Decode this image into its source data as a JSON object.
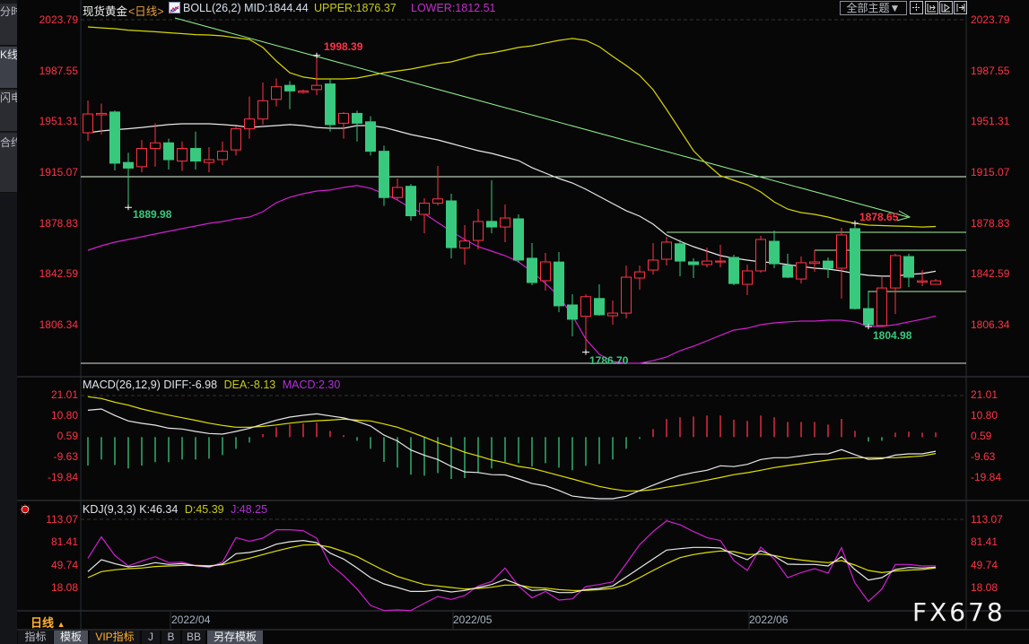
{
  "sidebar": {
    "tabs": [
      {
        "label": "分时图",
        "active": false
      },
      {
        "label": "K线图",
        "active": true
      },
      {
        "label": "闪电图",
        "active": false
      },
      {
        "label": "合约资料",
        "active": false
      }
    ]
  },
  "header": {
    "symbol": "现货黄金",
    "period": "<日线>",
    "indicator_icon": "chart-icon",
    "boll_mid": "BOLL(26,2) MID:1844.44",
    "boll_upper": "UPPER:1876.37",
    "boll_lower": "LOWER:1812.51",
    "theme_button": "全部主题▼",
    "tool_icons": [
      "crosshair-icon",
      "zoom-left-icon",
      "play-forward-icon",
      "jump-end-icon"
    ]
  },
  "macd_header": {
    "name": "MACD(26,12,9)",
    "diff": "DIFF:-6.98",
    "dea": "DEA:-8.13",
    "macd": "MACD:2.30"
  },
  "kdj_header": {
    "name": "KDJ(9,3,3)",
    "k": "K:46.34",
    "d": "D:45.39",
    "j": "J:48.25"
  },
  "footer": {
    "period_label": "日线",
    "period_arrow": "▲",
    "dates": [
      "2022/04",
      "2022/05",
      "2022/06"
    ],
    "tabs": [
      {
        "label": "指标",
        "highlight": false
      },
      {
        "label": "模板",
        "highlight": true
      },
      {
        "label": "VIP指标",
        "highlight": false
      },
      {
        "label": "J",
        "highlight": false
      },
      {
        "label": "B",
        "highlight": false
      },
      {
        "label": "BB",
        "highlight": false
      },
      {
        "label": "另存模板",
        "highlight": true
      }
    ],
    "watermark": "FX678"
  },
  "colors": {
    "up": "#ff3346",
    "down": "#38c97e",
    "boll_upper": "#d6d600",
    "boll_mid": "#e8e8e8",
    "boll_lower": "#d020d0",
    "diff": "#e8e8e8",
    "dea": "#e0e000",
    "k": "#e8e8e8",
    "d": "#e0e000",
    "j": "#d020d0",
    "axis_text": "#ff3346"
  },
  "chart_data": [
    {
      "type": "candlestick",
      "title": "现货黄金",
      "y_ticks": [
        "2023.79",
        "1987.55",
        "1951.31",
        "1915.07",
        "1878.83",
        "1842.59",
        "1806.34"
      ],
      "ylim": [
        1778.8,
        2023.79
      ],
      "x_ticks": [
        "2022/04",
        "2022/05",
        "2022/06"
      ],
      "ohlc": [
        [
          1943.2,
          1966.2,
          1937.4,
          1956.6
        ],
        [
          1956,
          1964,
          1942,
          1957
        ],
        [
          1958,
          1959,
          1916.3,
          1921.5
        ],
        [
          1922,
          1929,
          1889.98,
          1918
        ],
        [
          1919,
          1938,
          1915,
          1932
        ],
        [
          1932,
          1950,
          1919,
          1936
        ],
        [
          1936,
          1939,
          1917,
          1924
        ],
        [
          1923,
          1937,
          1916,
          1932
        ],
        [
          1932,
          1944,
          1917,
          1923
        ],
        [
          1922,
          1933,
          1915,
          1924
        ],
        [
          1924,
          1937,
          1920,
          1930
        ],
        [
          1931,
          1948,
          1927,
          1946
        ],
        [
          1946,
          1969,
          1939,
          1953
        ],
        [
          1953,
          1979,
          1949,
          1966
        ],
        [
          1967,
          1982,
          1962,
          1976
        ],
        [
          1977,
          1980,
          1960,
          1973
        ],
        [
          1972,
          1974,
          1971,
          1973
        ],
        [
          1974,
          1998.39,
          1970,
          1977
        ],
        [
          1978,
          1982,
          1944,
          1949
        ],
        [
          1950,
          1958,
          1939,
          1957
        ],
        [
          1957,
          1959,
          1937,
          1950
        ],
        [
          1951,
          1955,
          1927,
          1930
        ],
        [
          1930,
          1934,
          1891,
          1897
        ],
        [
          1897,
          1910.6,
          1895.2,
          1904.2
        ],
        [
          1905,
          1906.7,
          1880.5,
          1884
        ],
        [
          1885,
          1896.5,
          1871.6,
          1893
        ],
        [
          1893,
          1919.5,
          1891.4,
          1896
        ],
        [
          1894.6,
          1899.7,
          1853.6,
          1861.3
        ],
        [
          1861,
          1877.3,
          1849.2,
          1866
        ],
        [
          1866.4,
          1888.8,
          1860,
          1879.9
        ],
        [
          1880,
          1909.3,
          1871.6,
          1876
        ],
        [
          1876,
          1892,
          1865.2,
          1882.4
        ],
        [
          1881.8,
          1885,
          1850.5,
          1852.4
        ],
        [
          1853.7,
          1864.5,
          1834.5,
          1836.4
        ],
        [
          1837.7,
          1857.5,
          1830.6,
          1851.1
        ],
        [
          1851,
          1858.1,
          1815.3,
          1819.8
        ],
        [
          1820.4,
          1828.1,
          1798,
          1810.2
        ],
        [
          1812.3,
          1828,
          1786.7,
          1826.3
        ],
        [
          1825,
          1835.1,
          1812.7,
          1813.4
        ],
        [
          1812.7,
          1823.6,
          1806.3,
          1814.6
        ],
        [
          1814.6,
          1848.5,
          1810.8,
          1840.2
        ],
        [
          1839.6,
          1848.5,
          1831.3,
          1844.0
        ],
        [
          1845.3,
          1864.5,
          1842.1,
          1852.4
        ],
        [
          1853,
          1869,
          1848.5,
          1865.2
        ],
        [
          1864,
          1867,
          1840.9,
          1851.7
        ],
        [
          1851.1,
          1853.7,
          1839.6,
          1849.2
        ],
        [
          1849.2,
          1861.3,
          1847.2,
          1851.7
        ],
        [
          1851,
          1863.3,
          1847.2,
          1851.7
        ],
        [
          1854.3,
          1856.2,
          1834.5,
          1835.7
        ],
        [
          1835.1,
          1849.2,
          1827.4,
          1844.7
        ],
        [
          1844.7,
          1869.7,
          1843.4,
          1867.1
        ],
        [
          1865.8,
          1873.5,
          1846.6,
          1849.8
        ],
        [
          1848.5,
          1856.9,
          1839.6,
          1840.2
        ],
        [
          1838.9,
          1854.9,
          1835.7,
          1850.5
        ],
        [
          1850,
          1859.4,
          1844,
          1851.1
        ],
        [
          1851.7,
          1854.3,
          1839.6,
          1846.6
        ],
        [
          1846.6,
          1875.4,
          1824.9,
          1870.3
        ],
        [
          1874.8,
          1878.65,
          1817.2,
          1817.8
        ],
        [
          1817.8,
          1830.6,
          1804.98,
          1806.3
        ],
        [
          1805.7,
          1840.2,
          1805,
          1832.5
        ],
        [
          1832.5,
          1856.9,
          1814,
          1855.6
        ],
        [
          1854.9,
          1856.9,
          1833.2,
          1840.2
        ],
        [
          1836.7,
          1845.3,
          1833.8,
          1837.6
        ],
        [
          1835.1,
          1838.9,
          1835,
          1837.6
        ]
      ],
      "boll_upper": [
        2018.7,
        2018.0,
        2017.4,
        2016.4,
        2015.8,
        2015.2,
        2014.5,
        2013.9,
        2013.2,
        2012.9,
        2012.3,
        2011.0,
        2009.7,
        2004.0,
        1994.4,
        1986.0,
        1982.9,
        1981.6,
        1981.6,
        1981.6,
        1982.2,
        1984.1,
        1986.0,
        1987.3,
        1988.6,
        1990.5,
        1992.5,
        1993.7,
        1996.3,
        1998.9,
        2000.1,
        2002.0,
        2004.0,
        2005.2,
        2007.2,
        2009.1,
        2010.4,
        2009.1,
        2004.6,
        1997.6,
        1991.2,
        1984.1,
        1973.9,
        1959.8,
        1945.1,
        1930.4,
        1920.8,
        1912.5,
        1909.3,
        1906.1,
        1901.0,
        1893.9,
        1888.8,
        1886.3,
        1885.0,
        1883.1,
        1880.5,
        1878.6,
        1877.3,
        1877.0,
        1876.7,
        1876.4,
        1876.0,
        1876.37
      ],
      "boll_mid": [
        1943.2,
        1944.5,
        1945.4,
        1946.1,
        1947.0,
        1948.0,
        1949.0,
        1949.6,
        1949.6,
        1949.6,
        1949.0,
        1948.3,
        1947.0,
        1947.7,
        1948.3,
        1949.0,
        1948.3,
        1947.0,
        1946.4,
        1946.4,
        1948.3,
        1948.3,
        1947.0,
        1944.5,
        1941.9,
        1940.0,
        1938.1,
        1935.5,
        1932.9,
        1930.4,
        1928.5,
        1925.9,
        1923.4,
        1918.3,
        1914.4,
        1910.6,
        1907.4,
        1902.9,
        1897.8,
        1892.7,
        1887.6,
        1883.7,
        1878.0,
        1870.3,
        1865.8,
        1862.0,
        1858.8,
        1855.6,
        1853.7,
        1852.4,
        1851.1,
        1850.5,
        1849.2,
        1847.9,
        1846.6,
        1846.0,
        1844.7,
        1842.8,
        1841.5,
        1840.9,
        1840.9,
        1842.2,
        1842.8,
        1844.44
      ],
      "boll_lower": [
        1859.4,
        1862.6,
        1865.2,
        1867.1,
        1869.0,
        1871.0,
        1872.9,
        1874.8,
        1876.7,
        1878.6,
        1879.9,
        1881.8,
        1883.1,
        1886.9,
        1893.3,
        1897.2,
        1899.7,
        1901.6,
        1902.3,
        1904.2,
        1905.5,
        1903.6,
        1899.7,
        1895.2,
        1889.5,
        1885.6,
        1879.2,
        1872.9,
        1867.1,
        1862.0,
        1858.8,
        1855.6,
        1851.1,
        1844.1,
        1835.7,
        1826.8,
        1812.7,
        1796.1,
        1785.2,
        1780.1,
        1778.8,
        1778.8,
        1780.7,
        1783.3,
        1787.8,
        1791.0,
        1794.8,
        1798.7,
        1802.5,
        1803.8,
        1806.3,
        1807.6,
        1808.3,
        1808.9,
        1808.9,
        1809.5,
        1809.5,
        1808.3,
        1805.1,
        1805.1,
        1806.3,
        1808.3,
        1810.2,
        1812.51
      ],
      "annotations": {
        "high": "1998.39",
        "low_left": "1889.98",
        "low_mid": "1786.70",
        "high_right": "1878.65",
        "low_right": "1804.98"
      }
    },
    {
      "type": "bar+line",
      "title": "MACD(26,12,9)",
      "y_ticks": [
        "21.01",
        "10.80",
        "0.59",
        "-9.63",
        "-19.84"
      ],
      "diff": [
        13.3,
        13.9,
        10.7,
        8.0,
        6.8,
        5.9,
        4.4,
        4.0,
        2.8,
        1.8,
        1.5,
        2.8,
        4.3,
        6.4,
        8.4,
        9.9,
        10.8,
        11.5,
        10.5,
        9.5,
        7.8,
        5.5,
        1.0,
        -1.9,
        -6.4,
        -9.0,
        -11.1,
        -14.5,
        -17.2,
        -17.5,
        -18.6,
        -18.7,
        -20.7,
        -23.0,
        -24.1,
        -26.4,
        -29.2,
        -30.0,
        -30.5,
        -30.5,
        -29.3,
        -26.5,
        -23.8,
        -21.2,
        -19.0,
        -17.5,
        -16.4,
        -14.2,
        -14.6,
        -13.5,
        -11.1,
        -10.2,
        -10.2,
        -9.3,
        -8.4,
        -8.3,
        -6.2,
        -8.7,
        -11.0,
        -10.7,
        -8.9,
        -8.3,
        -8.3,
        -6.98
      ],
      "dea": [
        20.0,
        19.1,
        17.3,
        15.8,
        13.9,
        12.4,
        10.9,
        9.6,
        8.3,
        6.9,
        5.8,
        4.9,
        4.9,
        5.3,
        6.0,
        6.9,
        7.6,
        8.1,
        8.4,
        8.9,
        8.4,
        8.0,
        6.5,
        4.9,
        2.5,
        0.0,
        -2.7,
        -4.9,
        -7.5,
        -9.3,
        -11.3,
        -12.7,
        -14.5,
        -15.5,
        -17.2,
        -19.0,
        -20.7,
        -22.6,
        -24.4,
        -25.7,
        -26.6,
        -26.6,
        -26.0,
        -24.8,
        -23.8,
        -22.6,
        -21.3,
        -20.0,
        -18.6,
        -17.6,
        -16.4,
        -15.1,
        -14.1,
        -13.2,
        -12.3,
        -11.4,
        -10.6,
        -10.2,
        -10.2,
        -10.2,
        -10.2,
        -9.8,
        -9.3,
        -8.13
      ],
      "macd": [
        -14.1,
        -11.1,
        -13.8,
        -15.5,
        -14.1,
        -12.4,
        -12.4,
        -11.1,
        -11.1,
        -10.7,
        -8.9,
        -5.8,
        -2.7,
        1.5,
        4.9,
        6.2,
        6.7,
        7.1,
        3.1,
        1.0,
        -1.8,
        -5.8,
        -12.3,
        -15.1,
        -18.6,
        -19.1,
        -17.8,
        -20.7,
        -20.3,
        -17.8,
        -15.5,
        -12.3,
        -12.9,
        -14.5,
        -12.9,
        -15.1,
        -16.4,
        -14.2,
        -13.3,
        -11.1,
        -5.8,
        -0.9,
        4.0,
        9.0,
        9.8,
        10.2,
        10.7,
        10.7,
        8.6,
        8.0,
        10.7,
        9.8,
        7.5,
        7.5,
        7.5,
        6.2,
        9.0,
        3.1,
        -2.2,
        -1.8,
        2.2,
        2.7,
        2.2,
        2.3
      ]
    },
    {
      "type": "line",
      "title": "KDJ(9,3,3)",
      "y_ticks": [
        "113.07",
        "81.41",
        "49.74",
        "18.08"
      ],
      "k": [
        40.1,
        56.8,
        51.3,
        46.7,
        48.4,
        52.6,
        50.1,
        51.3,
        48.4,
        47.2,
        50.9,
        65.1,
        66.8,
        70.9,
        78.4,
        81.8,
        83.5,
        80.5,
        65.9,
        57.6,
        45.1,
        31.7,
        23.0,
        18.0,
        12.5,
        12.5,
        14.6,
        11.7,
        13.8,
        18.0,
        22.1,
        29.2,
        22.1,
        13.8,
        15.0,
        10.9,
        10.9,
        15.0,
        16.7,
        20.1,
        32.6,
        45.1,
        57.6,
        70.1,
        72.2,
        73.9,
        73.9,
        73.0,
        63.9,
        56.8,
        69.3,
        61.8,
        50.5,
        50.1,
        50.1,
        48.0,
        60.9,
        43.0,
        28.4,
        31.7,
        43.0,
        45.9,
        45.1,
        46.34
      ],
      "d": [
        31.7,
        40.1,
        42.6,
        44.2,
        45.1,
        47.2,
        48.0,
        48.8,
        48.8,
        48.4,
        49.7,
        54.3,
        58.8,
        63.9,
        68.9,
        73.4,
        77.2,
        77.6,
        74.3,
        68.0,
        61.0,
        51.3,
        41.7,
        33.4,
        27.6,
        22.1,
        20.1,
        18.0,
        15.9,
        16.7,
        18.4,
        21.3,
        21.3,
        18.0,
        17.1,
        15.0,
        13.8,
        13.8,
        15.0,
        16.7,
        22.1,
        31.7,
        41.7,
        51.3,
        59.7,
        63.9,
        66.8,
        68.9,
        68.0,
        63.9,
        64.7,
        62.6,
        58.8,
        56.3,
        54.3,
        52.6,
        55.5,
        49.2,
        41.7,
        38.8,
        40.9,
        42.2,
        43.0,
        45.39
      ],
      "j": [
        58.8,
        88.5,
        62.6,
        48.0,
        54.7,
        61.0,
        52.6,
        53.4,
        48.4,
        45.9,
        53.4,
        87.6,
        82.6,
        86.8,
        98.5,
        98.5,
        97.2,
        86.8,
        50.1,
        34.6,
        15.9,
        -7.1,
        -14.2,
        -13.3,
        -14.2,
        -4.1,
        5.5,
        1.3,
        6.7,
        20.1,
        26.3,
        45.1,
        20.1,
        3.4,
        12.5,
        0.4,
        2.1,
        19.2,
        22.1,
        25.9,
        51.3,
        77.6,
        96.0,
        111.0,
        105.6,
        96.0,
        87.6,
        83.5,
        55.5,
        41.7,
        74.3,
        57.6,
        31.7,
        38.8,
        44.2,
        38.0,
        73.4,
        24.2,
        -1.6,
        15.9,
        50.1,
        50.1,
        48.0,
        48.25
      ]
    }
  ]
}
